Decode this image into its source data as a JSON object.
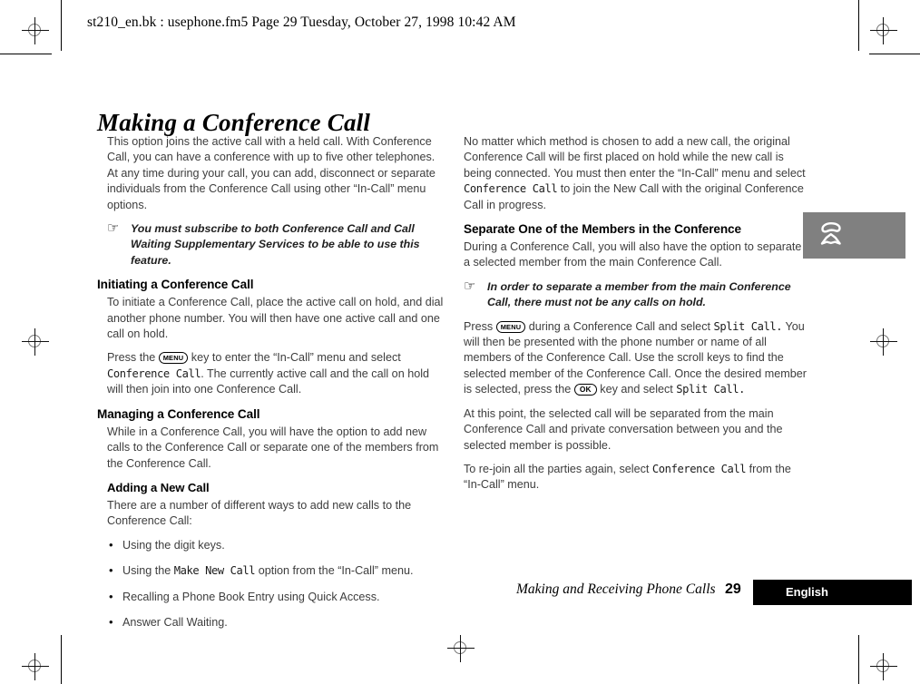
{
  "header": {
    "filename_line": "st210_en.bk : usephone.fm5  Page 29  Tuesday, October 27, 1998  10:42 AM"
  },
  "page_title": "Making a Conference Call",
  "icons": {
    "note_hand": "☞",
    "margin_tab": "phone-handset-icon"
  },
  "left_column": {
    "intro_paragraph": "This option joins the active call with a held call. With Conference Call, you can have a conference with up to five other telephones. At any time during your call, you can add, disconnect or separate individuals from the Conference Call using other “In-Call” menu options.",
    "note_1": "You must subscribe to both Conference Call and Call Waiting Supplementary Services to be able to use this feature.",
    "heading_initiating": "Initiating a Conference Call",
    "initiating_p1": "To initiate a Conference Call, place the active call on hold, and dial another phone number. You will then have one active call and one call on hold.",
    "initiating_p2_a": "Press the",
    "key_menu": "MENU",
    "initiating_p2_b": "key to enter the “In-Call” menu and select",
    "code_conference_call": "Conference Call",
    "initiating_p2_c": ". The currently active call and the call on hold will then join into one Conference Call.",
    "heading_managing": "Managing a Conference Call",
    "managing_p1": "While in a Conference Call, you will have the option to add new calls to the Conference Call or separate one of the members from the Conference Call.",
    "heading_adding": "Adding a New Call",
    "adding_p1": "There are a number of different ways to add new calls to the Conference Call:",
    "bullets": [
      {
        "pre": "Using the digit keys.",
        "code": "",
        "post": ""
      },
      {
        "pre": "Using the",
        "code": "Make New Call",
        "post": "option from the “In-Call” menu."
      },
      {
        "pre": "Recalling a Phone Book Entry using Quick Access.",
        "code": "",
        "post": ""
      },
      {
        "pre": "Answer Call Waiting.",
        "code": "",
        "post": ""
      }
    ]
  },
  "right_column": {
    "p1_a": "No matter which method is chosen to add a new call, the original Conference Call will be first placed on hold while the new call is being connected. You must then enter the “In-Call” menu and select",
    "p1_code": "Conference Call",
    "p1_b": "to join the New Call with the original Conference Call in progress.",
    "heading_separate": "Separate One of the Members in the Conference",
    "separate_p1": "During a Conference Call, you will also have the option to separate a selected member from the main Conference Call.",
    "note_2": "In order to separate a member from the main Conference Call, there must not be any calls on hold.",
    "p2_a": "Press",
    "key_menu": "MENU",
    "p2_b": "during a Conference Call and select",
    "p2_code": "Split Call.",
    "p2_c": "You will then be presented with the phone number or name of all members of the Conference Call. Use the scroll keys to find the selected member of the Conference Call. Once the desired member is selected, press the",
    "key_ok": "OK",
    "p2_d": "key and select",
    "p2_code2": "Split Call.",
    "p3": "At this point, the selected call will be separated from the main Conference Call and private conversation between you and the selected member is possible.",
    "p4_a": "To re-join all the parties again, select",
    "p4_code": "Conference Call",
    "p4_b": "from the “In-Call” menu."
  },
  "footer": {
    "section_title": "Making and Receiving Phone Calls",
    "page_number": "29",
    "language": "English"
  },
  "colors": {
    "margin_tab_gray": "#808080",
    "footer_bar_black": "#000000",
    "body_text": "#3d3d3d"
  }
}
